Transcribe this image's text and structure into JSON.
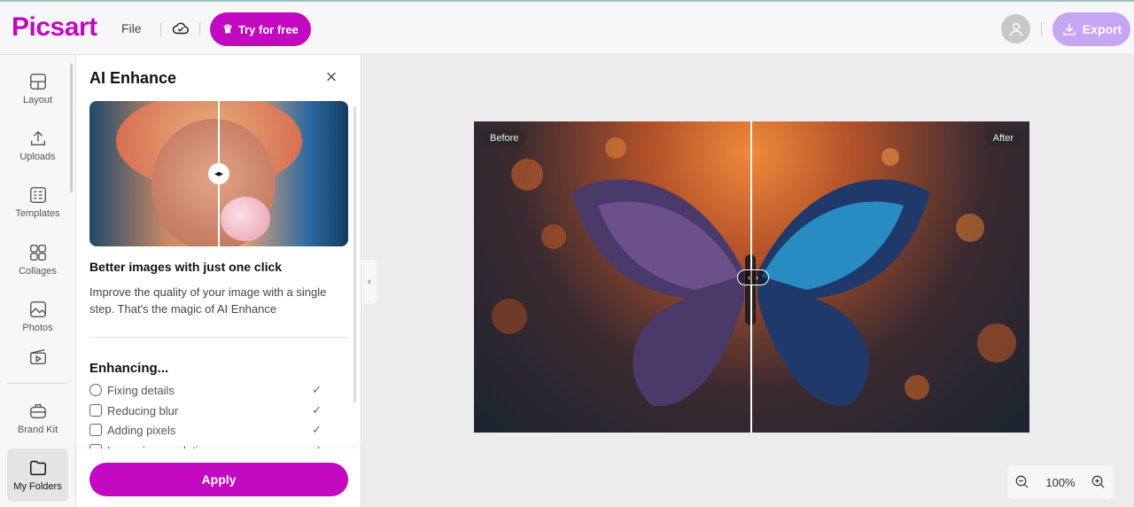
{
  "header": {
    "logo": "Picsart",
    "file": "File",
    "try_label": "Try for free",
    "export_label": "Export"
  },
  "sidebar": {
    "items": [
      {
        "label": "Layout",
        "icon": "layout-icon"
      },
      {
        "label": "Uploads",
        "icon": "upload-icon"
      },
      {
        "label": "Templates",
        "icon": "templates-icon"
      },
      {
        "label": "Collages",
        "icon": "collages-icon"
      },
      {
        "label": "Photos",
        "icon": "photos-icon"
      },
      {
        "label": "",
        "icon": "video-icon"
      },
      {
        "label": "Brand Kit",
        "icon": "brand-kit-icon"
      },
      {
        "label": "My Folders",
        "icon": "folder-icon",
        "active": true
      }
    ]
  },
  "panel": {
    "title": "AI Enhance",
    "subtitle": "Better images with just one click",
    "description": "Improve the quality of your image with a single step. That's the magic of AI Enhance",
    "enhancing": "Enhancing...",
    "steps": [
      {
        "label": "Fixing details",
        "done": true
      },
      {
        "label": "Reducing blur",
        "done": true
      },
      {
        "label": "Adding pixels",
        "done": true
      },
      {
        "label": "Improving resolution",
        "done": true
      }
    ],
    "apply_label": "Apply"
  },
  "canvas": {
    "before_label": "Before",
    "after_label": "After"
  },
  "zoom": {
    "level": "100%"
  },
  "colors": {
    "brand": "#c209c1",
    "export": "#c6a6f2"
  }
}
